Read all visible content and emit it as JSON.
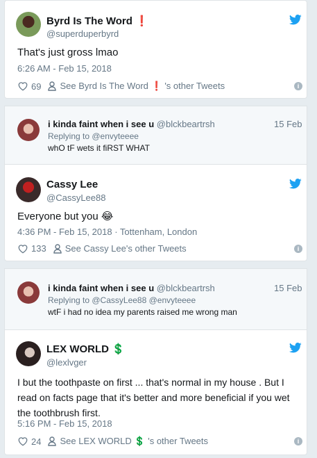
{
  "tweets": [
    {
      "name": "Byrd Is The Word",
      "name_emoji": "❗",
      "handle": "@superduperbyrd",
      "text": "That's just gross lmao",
      "timestamp": "6:26 AM - Feb 15, 2018",
      "likes": "69",
      "see_other": "See Byrd Is The Word",
      "see_other_emoji": "❗",
      "see_other_suffix": "'s other Tweets"
    },
    {
      "name": "Cassy Lee",
      "handle": "@CassyLee88",
      "text": "Everyone but you",
      "text_emoji": "😂",
      "timestamp": "4:36 PM - Feb 15, 2018 · Tottenham, London",
      "likes": "133",
      "see_other": "See Cassy Lee's other Tweets"
    },
    {
      "name": "LEX WORLD",
      "name_emoji": "💲",
      "handle": "@lexlvger",
      "text_lines": [
        "I but the toothpaste on first ... that's normal in my house . But I",
        "read on facts page that it's better and more beneficial if you wet",
        "the toothbrush first."
      ],
      "timestamp": "5:16 PM - Feb 15, 2018",
      "likes": "24",
      "see_other": "See LEX WORLD",
      "see_other_emoji": "💲",
      "see_other_suffix": "'s other Tweets"
    }
  ],
  "replies": [
    {
      "name": "i kinda faint when i see u",
      "handle": "@blckbeartrsh",
      "date": "15 Feb",
      "replying_to": "Replying to @envyteeee",
      "text": "whO tF wets it fiRST WHAT"
    },
    {
      "name": "i kinda faint when i see u",
      "handle": "@blckbeartrsh",
      "date": "15 Feb",
      "replying_to": "Replying to @CassyLee88 @envyteeee",
      "text": "wtF i had no idea my parents raised me wrong man"
    }
  ],
  "colors": {
    "twitter_blue": "#1da1f2",
    "meta_gray": "#657786",
    "background": "#e6ecf0"
  }
}
